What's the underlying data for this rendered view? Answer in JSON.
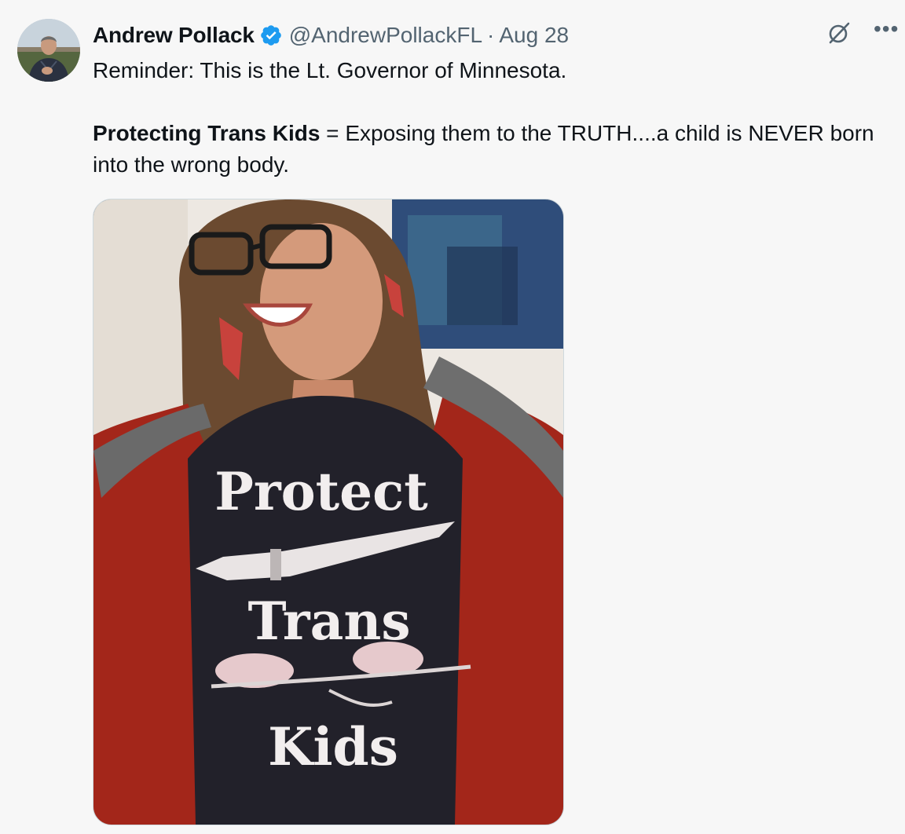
{
  "author": {
    "name": "Andrew Pollack",
    "handle": "@AndrewPollackFL",
    "separator": "·",
    "date": "Aug 28",
    "verified": true
  },
  "tweet": {
    "line1": "Reminder: This is the Lt. Governor of Minnesota.",
    "bold_part": "Protecting Trans Kids",
    "rest_part": " = Exposing them to the TRUTH....a child is NEVER born into the wrong body."
  },
  "image": {
    "shirt_line1": "Protect",
    "shirt_line2": "Trans",
    "shirt_line3": "Kids"
  },
  "icons": {
    "verified": "verified-badge-icon",
    "grok": "grok-icon",
    "more": "more-icon"
  },
  "colors": {
    "accent": "#1d9bf0",
    "muted": "#536471",
    "text": "#0f1419",
    "background": "#f7f7f7"
  }
}
